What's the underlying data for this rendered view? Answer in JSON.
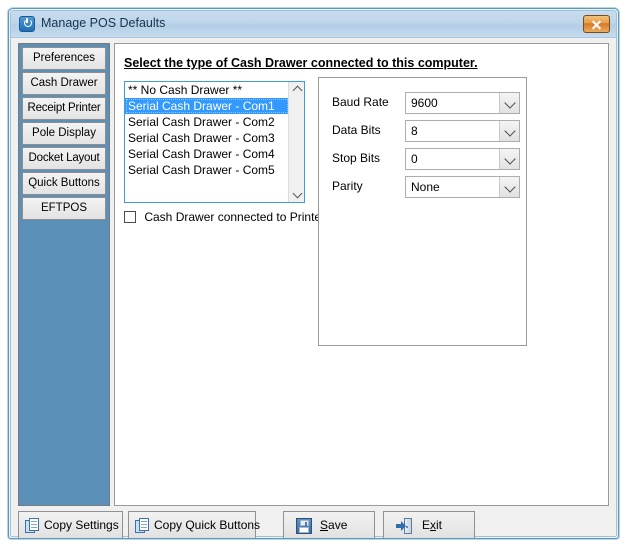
{
  "window": {
    "title": "Manage POS Defaults",
    "icon": "power-icon",
    "close_label": "X",
    "accent_blue": "#5b90b8",
    "titlebar_color": "#bed5ea",
    "close_button_color": "#d7792a",
    "selection_color": "#3399ff"
  },
  "sidebar": {
    "items": [
      {
        "label": "Preferences"
      },
      {
        "label": "Cash Drawer"
      },
      {
        "label": "Receipt Printer"
      },
      {
        "label": "Pole Display"
      },
      {
        "label": "Docket Layout"
      },
      {
        "label": "Quick Buttons"
      },
      {
        "label": "EFTPOS"
      }
    ]
  },
  "content": {
    "heading": "Select the type of Cash Drawer connected to this computer.",
    "drawer_list": {
      "items": [
        {
          "label": "** No Cash Drawer **",
          "selected": false
        },
        {
          "label": "Serial Cash Drawer - Com1",
          "selected": true
        },
        {
          "label": "Serial Cash Drawer - Com2",
          "selected": false
        },
        {
          "label": "Serial Cash Drawer - Com3",
          "selected": false
        },
        {
          "label": "Serial Cash Drawer - Com4",
          "selected": false
        },
        {
          "label": "Serial Cash Drawer - Com5",
          "selected": false
        }
      ]
    },
    "printer_checkbox": {
      "label": "Cash Drawer connected to Printer",
      "checked": false
    },
    "serial_settings": {
      "baud_rate": {
        "label": "Baud Rate",
        "value": "9600"
      },
      "data_bits": {
        "label": "Data Bits",
        "value": "8"
      },
      "stop_bits": {
        "label": "Stop Bits",
        "value": "0"
      },
      "parity": {
        "label": "Parity",
        "value": "None"
      }
    }
  },
  "buttons": {
    "copy_settings": "Copy Settings",
    "copy_quick_buttons": "Copy Quick Buttons",
    "save": {
      "prefix": "",
      "mnemonic": "S",
      "suffix": "ave"
    },
    "exit": {
      "prefix": "E",
      "mnemonic": "x",
      "suffix": "it"
    }
  }
}
